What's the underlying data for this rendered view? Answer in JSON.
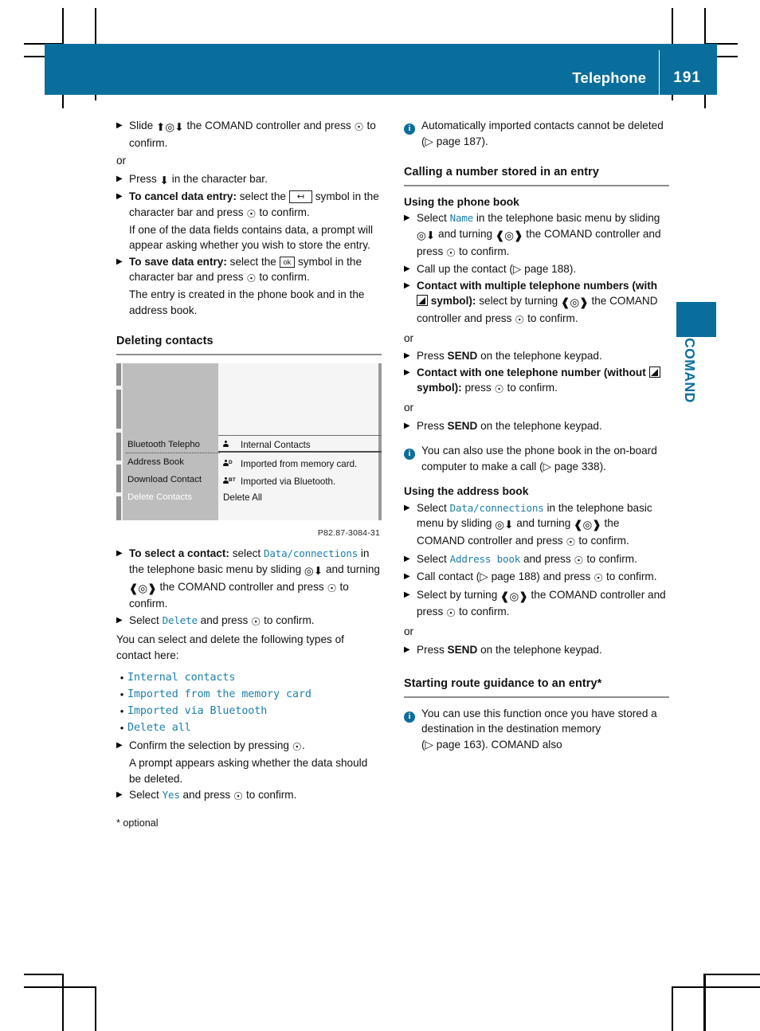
{
  "colors": {
    "brand": "#0a6e9c",
    "menu_blue": "#1d7fa8",
    "rule_gray": "#8d8d8d"
  },
  "header": {
    "title": "Telephone",
    "page_number": "191"
  },
  "thumb_tab": {
    "label": "COMAND"
  },
  "left_column": {
    "step_slide": {
      "pre": "Slide",
      "mid": "the COMAND controller and press",
      "post": "to confirm."
    },
    "or_1": "or",
    "step_press_char_bar": {
      "pre": "Press",
      "post": "in the character bar."
    },
    "step_cancel": {
      "lead": "To cancel data entry:",
      "pre": "select the",
      "icon_label": "back-arrow",
      "mid": "symbol in the character bar and press",
      "post": "to confirm.",
      "extra": "If one of the data fields contains data, a prompt will appear asking whether you wish to store the entry."
    },
    "step_save": {
      "lead": "To save data entry:",
      "pre": "select the",
      "icon_label": "ok",
      "mid": "symbol in the character bar and press",
      "post": "to confirm.",
      "extra": "The entry is created in the phone book and in the address book."
    },
    "heading_deleting": "Deleting contacts",
    "figure": {
      "left_menu": [
        "Bluetooth Telepho",
        "Address Book",
        "Download Contact",
        "Delete Contacts"
      ],
      "left_menu_selected_index": 3,
      "right_menu": [
        {
          "icon": "person",
          "label": "Internal Contacts"
        },
        {
          "icon": "person-d",
          "label": "Imported from memory card."
        },
        {
          "icon": "person-bt",
          "label": "Imported via Bluetooth."
        },
        {
          "icon": "",
          "label": "Delete All"
        }
      ],
      "caption": "P82.87-3084-31"
    },
    "step_select_contact": {
      "lead": "To select a contact:",
      "pre": "select",
      "menu": "Data/connections",
      "mid1": "in the telephone basic menu by sliding",
      "mid2": "and turning",
      "mid3": "the COMAND controller and press",
      "post": "to confirm."
    },
    "step_select_delete": {
      "pre": "Select",
      "menu": "Delete",
      "mid": "and press",
      "post": "to confirm."
    },
    "para_types": "You can select and delete the following types of contact here:",
    "contact_types": [
      "Internal contacts",
      "Imported from the memory card",
      "Imported via Bluetooth",
      "Delete all"
    ],
    "step_confirm_selection": {
      "pre": "Confirm the selection by pressing",
      "post": ".",
      "extra": "A prompt appears asking whether the data should be deleted."
    },
    "step_select_yes": {
      "pre": "Select",
      "menu": "Yes",
      "mid": "and press",
      "post": "to confirm."
    },
    "footnote": "* optional"
  },
  "right_column": {
    "note_auto_import": {
      "text": "Automatically imported contacts cannot be deleted (",
      "ref": "page 187",
      "text_end": ")."
    },
    "heading_calling": "Calling a number stored in an entry",
    "subheading_phone_book": "Using the phone book",
    "step_select_name": {
      "pre": "Select",
      "menu": "Name",
      "mid1": "in the telephone basic menu by sliding",
      "mid2": "and turning",
      "mid3": "the COMAND controller and press",
      "post": "to confirm."
    },
    "step_call_up": {
      "pre": "Call up the contact (",
      "ref": "page 188",
      "post": ")."
    },
    "step_multiple": {
      "lead1": "Contact with multiple telephone numbers (with",
      "lead2": "symbol):",
      "mid1": "select by turning",
      "mid2": "the COMAND controller and press",
      "post": "to confirm."
    },
    "or_1": "or",
    "step_send_1": {
      "pre": "Press",
      "key": "SEND",
      "post": "on the telephone keypad."
    },
    "step_single": {
      "lead1": "Contact with one telephone number (without",
      "lead2": "symbol):",
      "mid": "press",
      "post": "to confirm."
    },
    "or_2": "or",
    "step_send_2": {
      "pre": "Press",
      "key": "SEND",
      "post": "on the telephone keypad."
    },
    "note_onboard": {
      "text": "You can also use the phone book in the on-board computer to make a call (",
      "ref": "page 338",
      "text_end": ")."
    },
    "subheading_address_book": "Using the address book",
    "step_select_dataconn": {
      "pre": "Select",
      "menu": "Data/connections",
      "mid1": "in the telephone basic menu by sliding",
      "mid2": "and turning",
      "mid3": "the COMAND controller and press",
      "post": "to confirm."
    },
    "step_select_address_book": {
      "pre": "Select",
      "menu": "Address book",
      "mid": "and press",
      "post": "to confirm."
    },
    "step_call_contact": {
      "pre": "Call contact (",
      "ref": "page 188",
      "mid": ") and press",
      "post": "to confirm."
    },
    "step_select_turning": {
      "pre": "Select by turning",
      "mid": "the COMAND controller and press",
      "post": "to confirm."
    },
    "or_3": "or",
    "step_send_3": {
      "pre": "Press",
      "key": "SEND",
      "post": "on the telephone keypad."
    },
    "heading_route_guidance": "Starting route guidance to an entry*",
    "note_route": {
      "text": "You can use this function once you have stored a destination in the destination memory (",
      "ref": "page 163",
      "text_end": "). COMAND also"
    }
  }
}
